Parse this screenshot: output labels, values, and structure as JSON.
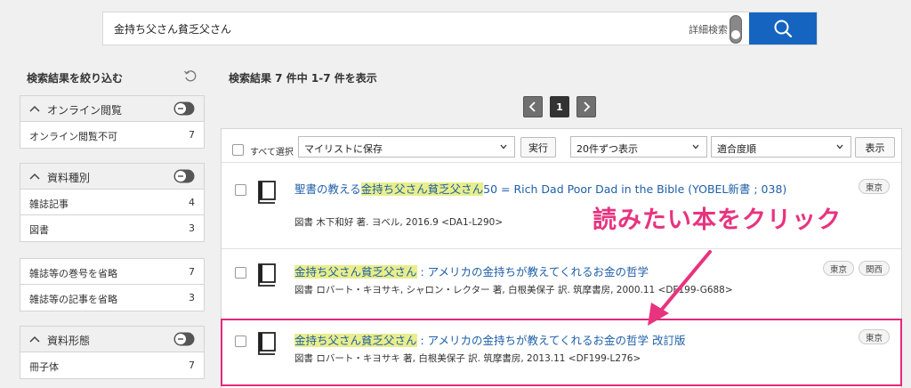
{
  "search": {
    "query": "金持ち父さん貧乏父さん",
    "advanced_label": "詳細検索"
  },
  "sidebar": {
    "title": "検索結果を絞り込む",
    "facets": [
      {
        "heading": "オンライン閲覧",
        "rows": [
          {
            "label": "オンライン閲覧不可",
            "count": "7"
          }
        ]
      },
      {
        "heading": "資料種別",
        "rows": [
          {
            "label": "雑誌記事",
            "count": "4"
          },
          {
            "label": "図書",
            "count": "3"
          }
        ]
      },
      {
        "heading": "",
        "rows": [
          {
            "label": "雑誌等の巻号を省略",
            "count": "7"
          },
          {
            "label": "雑誌等の記事を省略",
            "count": "3"
          }
        ]
      },
      {
        "heading": "資料形態",
        "rows": [
          {
            "label": "冊子体",
            "count": "7"
          }
        ]
      }
    ]
  },
  "results": {
    "summary": "検索結果 7 件中 1-7 件を表示",
    "page": "1",
    "toolbar": {
      "select_all": "すべて選択",
      "mylist": "マイリストに保存",
      "run": "実行",
      "per_page": "20件ずつ表示",
      "sort": "適合度順",
      "show": "表示"
    },
    "items": [
      {
        "title_pre": "聖書の教える",
        "title_hl": "金持ち父さん貧乏父さん",
        "title_post": "50 = Rich Dad Poor Dad in the Bible (YOBEL新書 ; 038)",
        "meta": "図書 木下和好 著. ヨベル, 2016.9 <DA1-L290>",
        "tags": [
          "東京"
        ]
      },
      {
        "title_pre": "",
        "title_hl": "金持ち父さん貧乏父さん",
        "title_post": " : アメリカの金持ちが教えてくれるお金の哲学",
        "meta": "図書 ロバート・キヨサキ, シャロン・レクター 著, 白根美保子 訳. 筑摩書房, 2000.11 <DF199-G688>",
        "tags": [
          "東京",
          "関西"
        ]
      },
      {
        "title_pre": "",
        "title_hl": "金持ち父さん貧乏父さん",
        "title_post": " : アメリカの金持ちが教えてくれるお金の哲学 改訂版",
        "meta": "図書 ロバート・キヨサキ 著, 白根美保子 訳. 筑摩書房, 2013.11 <DF199-L276>",
        "tags": [
          "東京"
        ]
      }
    ]
  },
  "annotation": {
    "text": "読みたい本をクリック",
    "color": "#e8337f"
  },
  "colors": {
    "accent": "#1565c0",
    "link": "#1f5fa8",
    "highlight": "#e9ee8a",
    "annotation": "#e4287b"
  }
}
